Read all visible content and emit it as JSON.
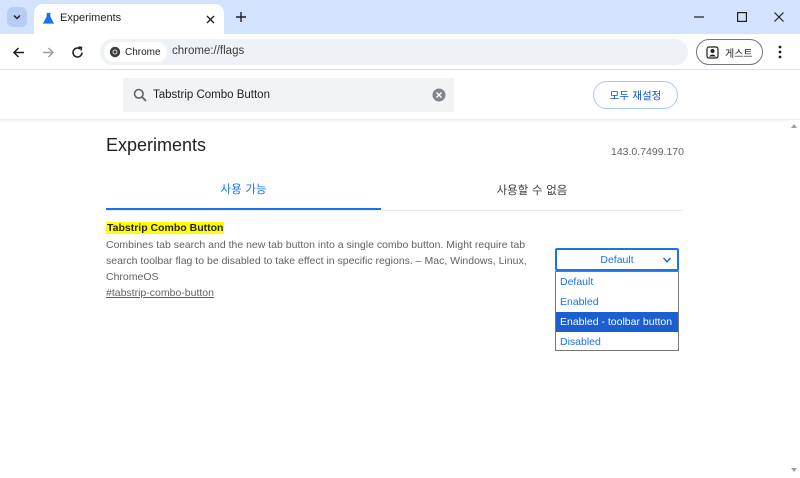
{
  "tab": {
    "title": "Experiments"
  },
  "omnibox": {
    "chip_label": "Chrome",
    "url": "chrome://flags"
  },
  "profile": {
    "label": "게스트"
  },
  "search": {
    "value": "Tabstrip Combo Button"
  },
  "reset_button": "모두 재설정",
  "page": {
    "title": "Experiments",
    "version": "143.0.7499.170",
    "tabs": [
      {
        "label": "사용 가능"
      },
      {
        "label": "사용할 수 없음"
      }
    ]
  },
  "flag": {
    "name": "Tabstrip Combo Button",
    "description": "Combines tab search and the new tab button into a single combo button. Might require tab search toolbar flag to be disabled to take effect in specific regions. – Mac, Windows, Linux, ChromeOS",
    "link": "#tabstrip-combo-button",
    "select_value": "Default",
    "options": [
      "Default",
      "Enabled",
      "Enabled - toolbar button",
      "Disabled"
    ],
    "highlighted_option": "Enabled - toolbar button"
  },
  "colors": {
    "tabstrip_bg": "#d3e3fd",
    "accent": "#1a73e8",
    "highlight": "#ffff00",
    "selected_option_bg": "#1a5fd0"
  }
}
